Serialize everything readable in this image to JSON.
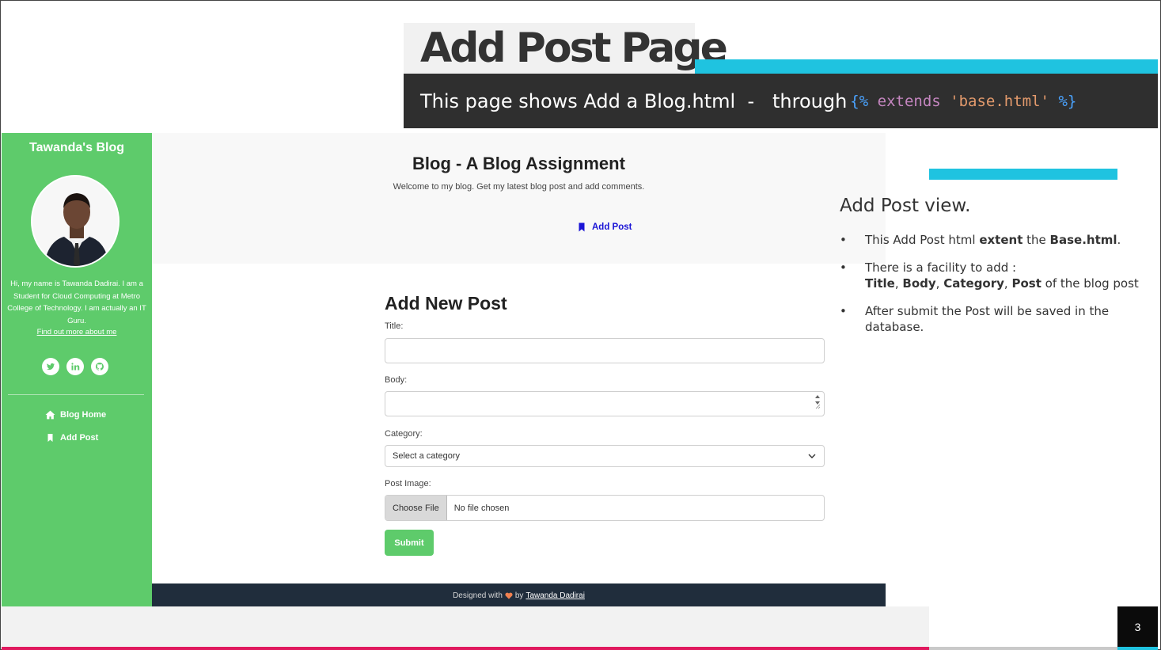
{
  "slide": {
    "title": "Add Post Page",
    "subtitle_text": "This page shows Add a Blog.html  -   through",
    "subtitle_code": {
      "open": "{%",
      "keyword": "extends",
      "string": "'base.html'",
      "close": "%}"
    },
    "page_number": "3",
    "colors": {
      "accent_cyan": "#1fc3e0",
      "accent_pink": "#e0195e",
      "dark_band": "#2f2f2f"
    }
  },
  "app": {
    "sidebar": {
      "brand": "Tawanda's Blog",
      "bio": "Hi, my name is Tawanda Dadirai. I am a Student for Cloud Computing at Metro College of Technology. I am actually an IT Guru.",
      "bio_link": "Find out more about me",
      "socials": [
        {
          "icon": "twitter-icon",
          "glyph": "t"
        },
        {
          "icon": "linkedin-icon",
          "glyph": "in"
        },
        {
          "icon": "github-icon",
          "glyph": "gh"
        }
      ],
      "nav": [
        {
          "icon": "home-icon",
          "label": "Blog Home"
        },
        {
          "icon": "bookmark-icon",
          "label": "Add Post"
        }
      ],
      "color": "#5ecb6b"
    },
    "hero": {
      "title": "Blog - A Blog Assignment",
      "subtitle": "Welcome to my blog. Get my latest blog post and add comments.",
      "link": "Add Post"
    },
    "form": {
      "title": "Add New Post",
      "title_label": "Title:",
      "title_value": "",
      "body_label": "Body:",
      "body_value": "",
      "category_label": "Category:",
      "category_selected": "Select a category",
      "image_label": "Post Image:",
      "choose_file": "Choose File",
      "no_file": "No file chosen",
      "submit": "Submit"
    },
    "footer": {
      "prefix": "Designed with",
      "by": "by",
      "author": "Tawanda Dadirai"
    }
  },
  "notes": {
    "heading": "Add Post view.",
    "items": [
      {
        "a": "This Add Post html ",
        "b": "extent",
        "c": " the ",
        "d": "Base.html",
        "e": "."
      },
      {
        "line1": "There is a facility to add :",
        "title": "Title",
        "body": "Body",
        "category": "Category",
        "post": "Post",
        "tail": " of the blog post"
      },
      {
        "text": "After submit the Post will be saved in the database."
      }
    ]
  }
}
